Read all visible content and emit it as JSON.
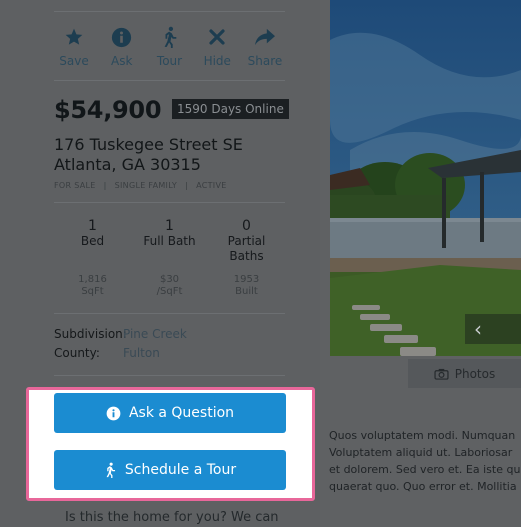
{
  "actions": [
    {
      "label": "Save",
      "icon": "star-icon"
    },
    {
      "label": "Ask",
      "icon": "info-icon"
    },
    {
      "label": "Tour",
      "icon": "walking-person-icon"
    },
    {
      "label": "Hide",
      "icon": "x-icon"
    },
    {
      "label": "Share",
      "icon": "share-arrow-icon"
    }
  ],
  "listing": {
    "price": "$54,900",
    "days_online": "1590 Days Online",
    "address_line1": "176 Tuskegee Street SE",
    "address_line2": "Atlanta, GA 30315",
    "tags": [
      "FOR SALE",
      "SINGLE FAMILY",
      "ACTIVE"
    ],
    "tag_separator": "|",
    "stats": [
      {
        "value": "1",
        "label": "Bed"
      },
      {
        "value": "1",
        "label": "Full Bath"
      },
      {
        "value": "0",
        "label": "Partial Baths"
      }
    ],
    "substats": [
      {
        "value": "1,816",
        "unit": "SqFt"
      },
      {
        "value": "$30",
        "unit": "/SqFt"
      },
      {
        "value": "1953",
        "unit": "Built"
      }
    ],
    "subdivision_label": "Subdivision:",
    "subdivision_value": "Pine Creek",
    "county_label": "County:",
    "county_value": "Fulton"
  },
  "buttons": {
    "ask_question": "Ask a Question",
    "schedule_tour": "Schedule a Tour"
  },
  "tagline": "Is this the home for you? We can",
  "gallery": {
    "photos_label": "Photos",
    "prev_label": "‹"
  },
  "description_lines": [
    "Quos voluptatem modi. Numquan",
    "Voluptatem aliquid ut. Laboriosar",
    "et dolorem. Sed vero et. Ea iste qu",
    "quaerat quo. Quo error et. Mollitia"
  ],
  "colors": {
    "accent": "#1b8cd1",
    "highlight_border": "#e8679a",
    "icon": "#1d3d50"
  }
}
